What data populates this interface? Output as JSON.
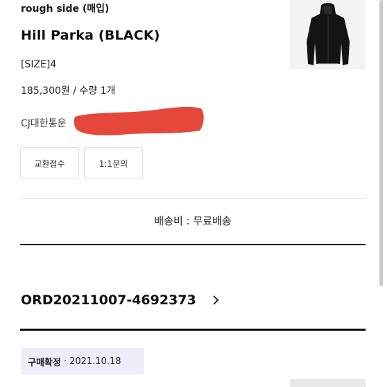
{
  "order": {
    "brand": "rough side (매입)",
    "product_name": "Hill Parka (BLACK)",
    "size": "[SIZE]4",
    "price_quantity": "185,300원 / 수량 1개",
    "courier": "CJ대한통운",
    "buttons": {
      "exchange": "교환접수",
      "inquiry": "1:1문의"
    },
    "shipping": "배송비 : 무료배송",
    "order_id": "ORD20211007-4692373",
    "status": "구매확정",
    "status_date": "· 2021.10.18"
  },
  "colors": {
    "redaction": "#e5483b",
    "status_bg": "#eceef9"
  },
  "icons": {
    "product_thumbnail": "black-hooded-parka",
    "order_link": "chevron-right-icon"
  }
}
